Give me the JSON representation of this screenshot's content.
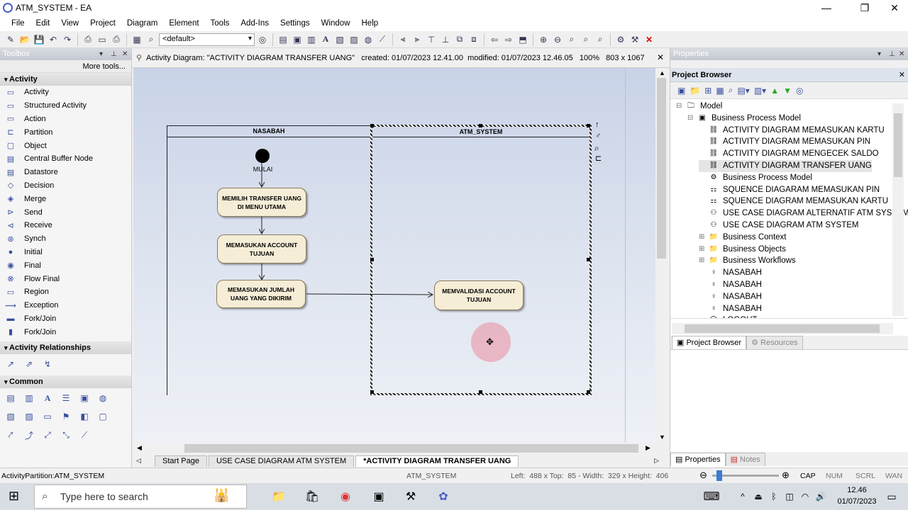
{
  "app": {
    "title": "ATM_SYSTEM - EA"
  },
  "menu": [
    "File",
    "Edit",
    "View",
    "Project",
    "Diagram",
    "Element",
    "Tools",
    "Add-Ins",
    "Settings",
    "Window",
    "Help"
  ],
  "toolbar": {
    "style_value": "<default>"
  },
  "toolbox": {
    "title": "Toolbox",
    "more_tools": "More tools...",
    "activity_section": "Activity",
    "items": [
      {
        "label": "Activity",
        "icon": "activity-icon"
      },
      {
        "label": "Structured Activity",
        "icon": "structured-activity-icon"
      },
      {
        "label": "Action",
        "icon": "action-icon"
      },
      {
        "label": "Partition",
        "icon": "partition-icon"
      },
      {
        "label": "Object",
        "icon": "object-icon"
      },
      {
        "label": "Central Buffer Node",
        "icon": "buffer-node-icon"
      },
      {
        "label": "Datastore",
        "icon": "datastore-icon"
      },
      {
        "label": "Decision",
        "icon": "decision-icon"
      },
      {
        "label": "Merge",
        "icon": "merge-icon"
      },
      {
        "label": "Send",
        "icon": "send-icon"
      },
      {
        "label": "Receive",
        "icon": "receive-icon"
      },
      {
        "label": "Synch",
        "icon": "synch-icon"
      },
      {
        "label": "Initial",
        "icon": "initial-icon"
      },
      {
        "label": "Final",
        "icon": "final-icon"
      },
      {
        "label": "Flow Final",
        "icon": "flow-final-icon"
      },
      {
        "label": "Region",
        "icon": "region-icon"
      },
      {
        "label": "Exception",
        "icon": "exception-icon"
      },
      {
        "label": "Fork/Join",
        "icon": "fork-join-icon"
      },
      {
        "label": "Fork/Join",
        "icon": "fork-join-vertical-icon"
      }
    ],
    "relationships_section": "Activity Relationships",
    "common_section": "Common"
  },
  "diagram": {
    "header": "Activity Diagram: \"ACTIVITY DIAGRAM TRANSFER UANG\"   created: 01/07/2023 12.41.00  modified: 01/07/2023 12.46.05   100%   803 x 1067",
    "lane1": "NASABAH",
    "lane2": "ATM_SYSTEM",
    "initial_label": "MULAI",
    "actions": [
      "MEMILIH TRANSFER UANG DI MENU UTAMA",
      "MEMASUKAN ACCOUNT TUJUAN",
      "MEMASUKAN JUMLAH UANG YANG DIKIRIM",
      "MEMVALIDASI ACCOUNT TUJUAN"
    ]
  },
  "tabs": [
    "Start Page",
    "USE CASE DIAGRAM ATM SYSTEM",
    "*ACTIVITY DIAGRAM TRANSFER UANG"
  ],
  "properties": {
    "title": "Properties"
  },
  "project_browser": {
    "title": "Project Browser",
    "tree": [
      {
        "label": "Model",
        "level": 0,
        "icon": "model-icon",
        "expander": "⊟"
      },
      {
        "label": "Business Process Model",
        "level": 1,
        "icon": "package-icon",
        "expander": "⊟"
      },
      {
        "label": "ACTIVITY DIAGRAM MEMASUKAN KARTU",
        "level": 2,
        "icon": "activity-diagram-icon"
      },
      {
        "label": "ACTIVITY DIAGRAM MEMASUKAN PIN",
        "level": 2,
        "icon": "activity-diagram-icon"
      },
      {
        "label": "ACTIVITY DIAGRAM MENGECEK SALDO",
        "level": 2,
        "icon": "activity-diagram-icon"
      },
      {
        "label": "ACTIVITY DIAGRAM TRANSFER UANG",
        "level": 2,
        "icon": "activity-diagram-icon",
        "selected": true
      },
      {
        "label": "Business Process Model",
        "level": 2,
        "icon": "business-process-icon"
      },
      {
        "label": "SQUENCE DIAGARAM MEMASUKAN PIN",
        "level": 2,
        "icon": "sequence-diagram-icon"
      },
      {
        "label": "SQUENCE DIAGRAM MEMASUKAN KARTU",
        "level": 2,
        "icon": "sequence-diagram-icon"
      },
      {
        "label": "USE CASE DIAGRAM ALTERNATIF ATM SYSTEM",
        "level": 2,
        "icon": "use-case-diagram-icon"
      },
      {
        "label": "USE CASE DIAGRAM ATM SYSTEM",
        "level": 2,
        "icon": "use-case-diagram-icon"
      },
      {
        "label": "Business Context",
        "level": 2,
        "icon": "folder-icon",
        "expander": "⊞"
      },
      {
        "label": "Business Objects",
        "level": 2,
        "icon": "folder-icon",
        "expander": "⊞"
      },
      {
        "label": "Business Workflows",
        "level": 2,
        "icon": "folder-icon",
        "expander": "⊞"
      },
      {
        "label": "NASABAH",
        "level": 2,
        "icon": "actor-icon"
      },
      {
        "label": "NASABAH",
        "level": 2,
        "icon": "actor-icon"
      },
      {
        "label": "NASABAH",
        "level": 2,
        "icon": "actor-icon"
      },
      {
        "label": "NASABAH",
        "level": 2,
        "icon": "actor-icon"
      },
      {
        "label": "LOGOUT",
        "level": 2,
        "icon": "use-case-icon"
      }
    ],
    "tab_browser": "Project Browser",
    "tab_resources": "Resources",
    "tab_properties": "Properties",
    "tab_notes": "Notes"
  },
  "status": {
    "left": "ActivityPartition:ATM_SYSTEM",
    "center": "ATM_SYSTEM",
    "geometry": "Left:  488 x Top:  85 - Width:  329 x Height:  406",
    "cap": "CAP",
    "num": "NUM",
    "scrl": "SCRL",
    "wan": "WAN"
  },
  "taskbar": {
    "search_placeholder": "Type here to search",
    "time": "12.46",
    "date": "01/07/2023"
  }
}
